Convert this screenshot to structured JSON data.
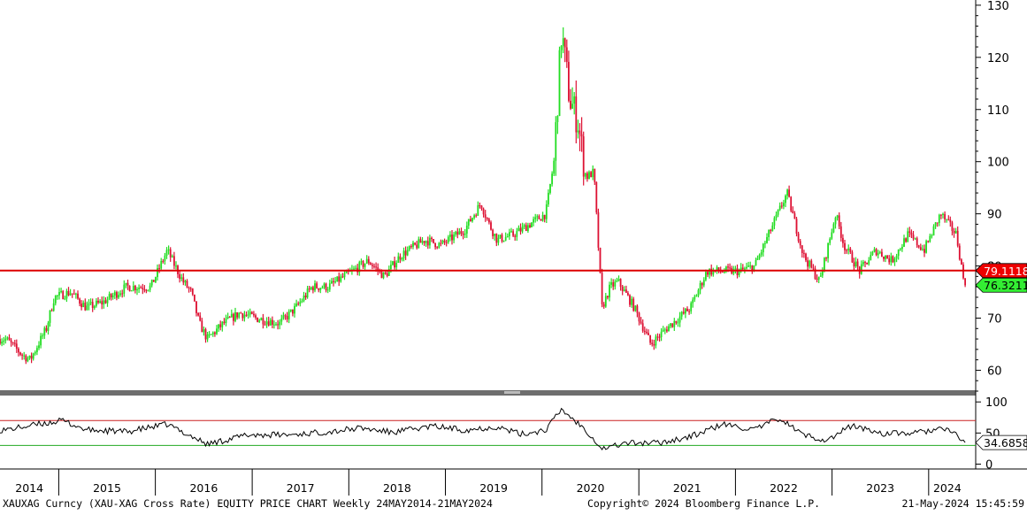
{
  "footer": {
    "left": "XAUXAG Curncy (XAU-XAG Cross Rate) EQUITY PRICE CHART  Weekly 24MAY2014-21MAY2024",
    "center": "Copyright© 2024 Bloomberg Finance L.P.",
    "right": "21-May-2024 15:45:59"
  },
  "colors": {
    "up": "#22dd22",
    "down": "#dd1133",
    "ma_line": "#dd0000",
    "rsi_line": "#000000",
    "rsi_upper": "#cc2222",
    "rsi_lower": "#22aa22",
    "last_price_box": "#33ee33",
    "ma_box": "#ee0000"
  },
  "chart_data": [
    {
      "type": "candlestick",
      "series_name": "XAUXAG Curncy",
      "frequency": "Weekly",
      "x_range": [
        "2014-05-24",
        "2024-05-21"
      ],
      "ylim": [
        56,
        131
      ],
      "y_ticks": [
        60,
        70,
        80,
        90,
        100,
        110,
        120,
        130
      ],
      "x_tick_labels": [
        "2014",
        "2015",
        "2016",
        "2017",
        "2018",
        "2019",
        "2020",
        "2021",
        "2022",
        "2023",
        "2024"
      ],
      "grid": false,
      "points": [
        [
          "2014-06",
          66
        ],
        [
          "2014-08",
          63
        ],
        [
          "2014-09",
          62
        ],
        [
          "2014-11",
          68
        ],
        [
          "2014-12",
          74
        ],
        [
          "2015-02",
          75
        ],
        [
          "2015-04",
          72
        ],
        [
          "2015-06",
          73
        ],
        [
          "2015-09",
          76
        ],
        [
          "2015-12",
          76
        ],
        [
          "2016-02",
          83
        ],
        [
          "2016-03",
          80
        ],
        [
          "2016-04",
          77
        ],
        [
          "2016-05",
          75
        ],
        [
          "2016-06",
          69
        ],
        [
          "2016-07",
          66
        ],
        [
          "2016-09",
          69
        ],
        [
          "2016-11",
          71
        ],
        [
          "2017-01",
          70
        ],
        [
          "2017-04",
          69
        ],
        [
          "2017-06",
          72
        ],
        [
          "2017-08",
          76
        ],
        [
          "2017-10",
          76
        ],
        [
          "2018-01",
          79
        ],
        [
          "2018-03",
          81
        ],
        [
          "2018-05",
          78
        ],
        [
          "2018-07",
          82
        ],
        [
          "2018-10",
          85
        ],
        [
          "2018-12",
          84
        ],
        [
          "2019-03",
          87
        ],
        [
          "2019-05",
          92
        ],
        [
          "2019-06",
          88
        ],
        [
          "2019-07",
          85
        ],
        [
          "2019-09",
          86
        ],
        [
          "2019-11",
          88
        ],
        [
          "2020-01",
          90
        ],
        [
          "2020-02",
          100
        ],
        [
          "2020-03",
          125
        ],
        [
          "2020-04",
          112
        ],
        [
          "2020-05",
          108
        ],
        [
          "2020-06",
          97
        ],
        [
          "2020-07",
          98
        ],
        [
          "2020-08",
          72
        ],
        [
          "2020-09",
          76
        ],
        [
          "2020-10",
          77
        ],
        [
          "2020-12",
          72
        ],
        [
          "2021-02",
          65
        ],
        [
          "2021-04",
          68
        ],
        [
          "2021-07",
          72
        ],
        [
          "2021-09",
          79
        ],
        [
          "2021-11",
          79
        ],
        [
          "2022-01",
          79
        ],
        [
          "2022-03",
          80
        ],
        [
          "2022-05",
          87
        ],
        [
          "2022-07",
          94
        ],
        [
          "2022-08",
          88
        ],
        [
          "2022-09",
          82
        ],
        [
          "2022-11",
          77
        ],
        [
          "2023-01",
          90
        ],
        [
          "2023-02",
          84
        ],
        [
          "2023-04",
          79
        ],
        [
          "2023-06",
          83
        ],
        [
          "2023-08",
          81
        ],
        [
          "2023-10",
          86
        ],
        [
          "2023-12",
          83
        ],
        [
          "2024-02",
          90
        ],
        [
          "2024-04",
          86
        ],
        [
          "2024-05",
          76.3211
        ]
      ],
      "moving_average_level": 79.1118,
      "last_price": 76.3211,
      "price_labels": [
        "79.1118",
        "76.3211"
      ]
    },
    {
      "type": "line",
      "series_name": "RSI",
      "ylim": [
        -5,
        106
      ],
      "y_ticks": [
        0,
        50,
        100
      ],
      "upper_band": 70,
      "lower_band": 30,
      "points": [
        [
          "2014-06",
          55
        ],
        [
          "2014-10",
          64
        ],
        [
          "2015-01",
          70
        ],
        [
          "2015-04",
          55
        ],
        [
          "2015-09",
          52
        ],
        [
          "2016-02",
          64
        ],
        [
          "2016-05",
          45
        ],
        [
          "2016-07",
          32
        ],
        [
          "2016-12",
          47
        ],
        [
          "2017-05",
          47
        ],
        [
          "2017-10",
          52
        ],
        [
          "2018-02",
          58
        ],
        [
          "2018-06",
          51
        ],
        [
          "2018-11",
          61
        ],
        [
          "2019-03",
          55
        ],
        [
          "2019-07",
          60
        ],
        [
          "2019-10",
          48
        ],
        [
          "2020-01",
          55
        ],
        [
          "2020-03",
          88
        ],
        [
          "2020-06",
          55
        ],
        [
          "2020-08",
          25
        ],
        [
          "2020-11",
          34
        ],
        [
          "2021-03",
          34
        ],
        [
          "2021-07",
          44
        ],
        [
          "2021-11",
          64
        ],
        [
          "2022-03",
          55
        ],
        [
          "2022-06",
          74
        ],
        [
          "2022-09",
          47
        ],
        [
          "2022-12",
          38
        ],
        [
          "2023-03",
          62
        ],
        [
          "2023-07",
          49
        ],
        [
          "2023-11",
          50
        ],
        [
          "2024-02",
          57
        ],
        [
          "2024-04",
          48
        ],
        [
          "2024-05",
          34.6858
        ]
      ],
      "last_value": 34.6858,
      "value_label": "34.6858"
    }
  ]
}
